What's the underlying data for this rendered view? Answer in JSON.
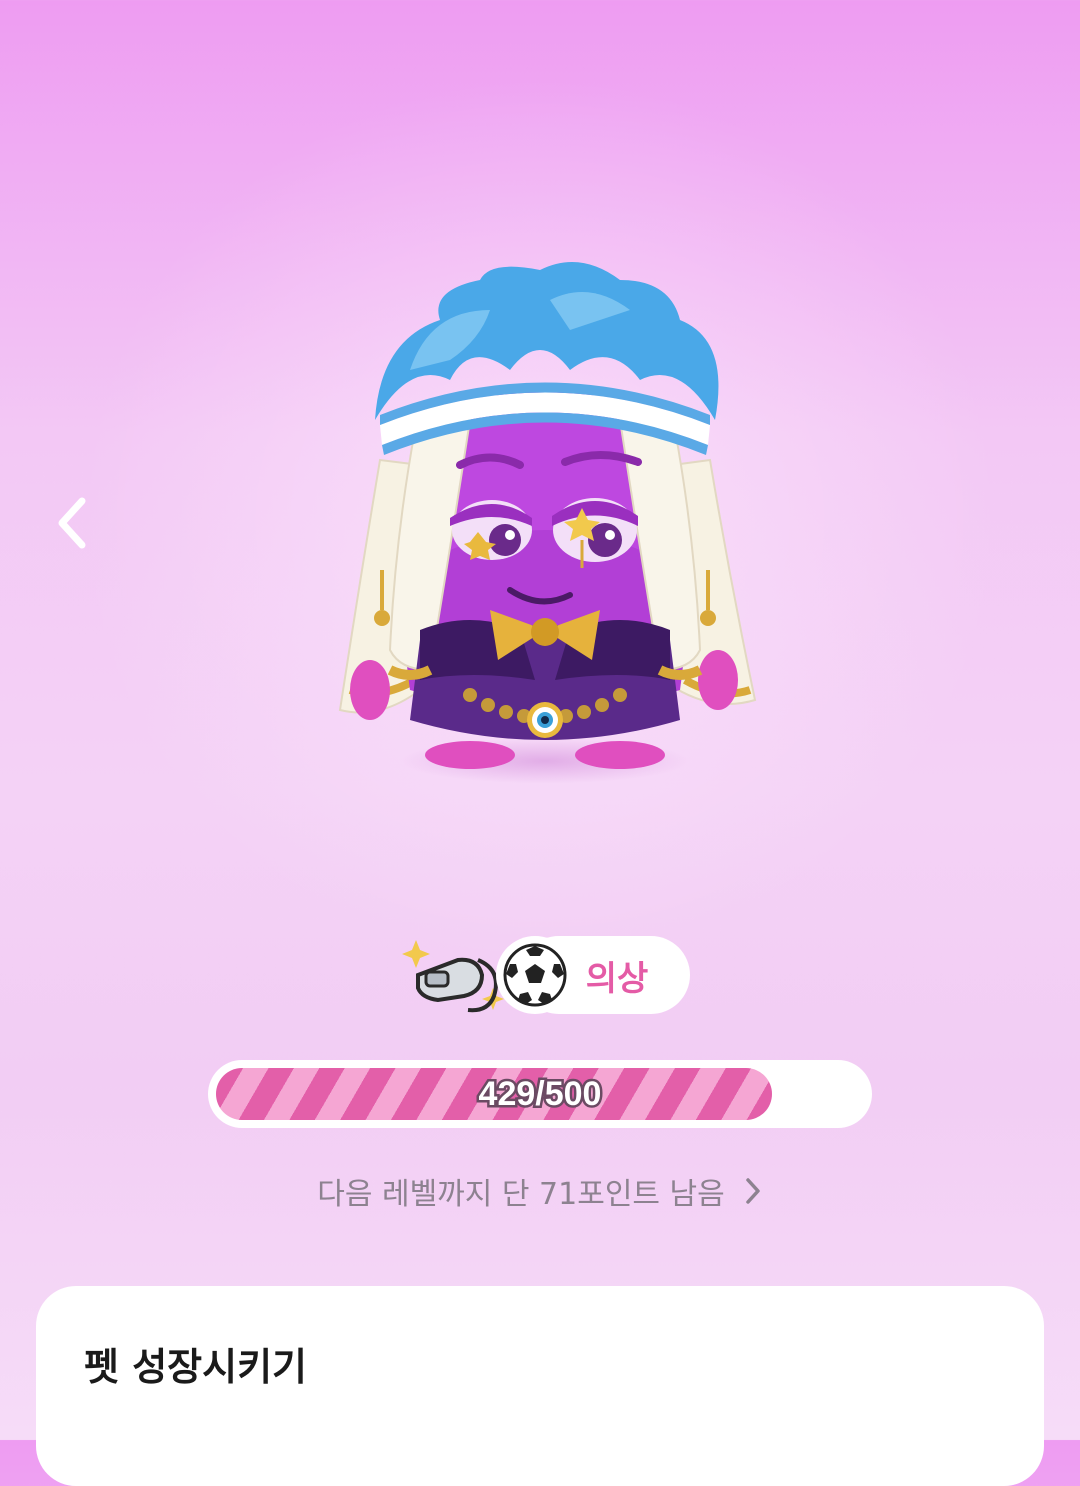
{
  "nav": {
    "back_icon": "chevron-left-icon"
  },
  "pet": {
    "image_desc_icon": "pet-character-icon",
    "colors": {
      "body": "#b23fd6",
      "hair": "#4aa8e8",
      "veil": "#f7f2e3",
      "gold": "#d9a93a",
      "robe": "#5a2a8a"
    }
  },
  "badges": {
    "whistle_icon": "whistle-icon",
    "ball_icon": "soccer-ball-icon",
    "costume_label": "의상"
  },
  "progress": {
    "current": 429,
    "max": 500,
    "fraction": 0.858,
    "label": "429/500"
  },
  "remaining": {
    "text": "다음 레벨까지 단 71포인트 남음",
    "chevron_icon": "chevron-right-icon"
  },
  "card": {
    "title": "펫 성장시키기"
  },
  "colors": {
    "accent": "#e45ba6",
    "progress_fill": "#e35fa9",
    "progress_stripe": "#f5a6d3",
    "background_top": "#ee9cf2",
    "background_bottom": "#f6dcf8"
  }
}
